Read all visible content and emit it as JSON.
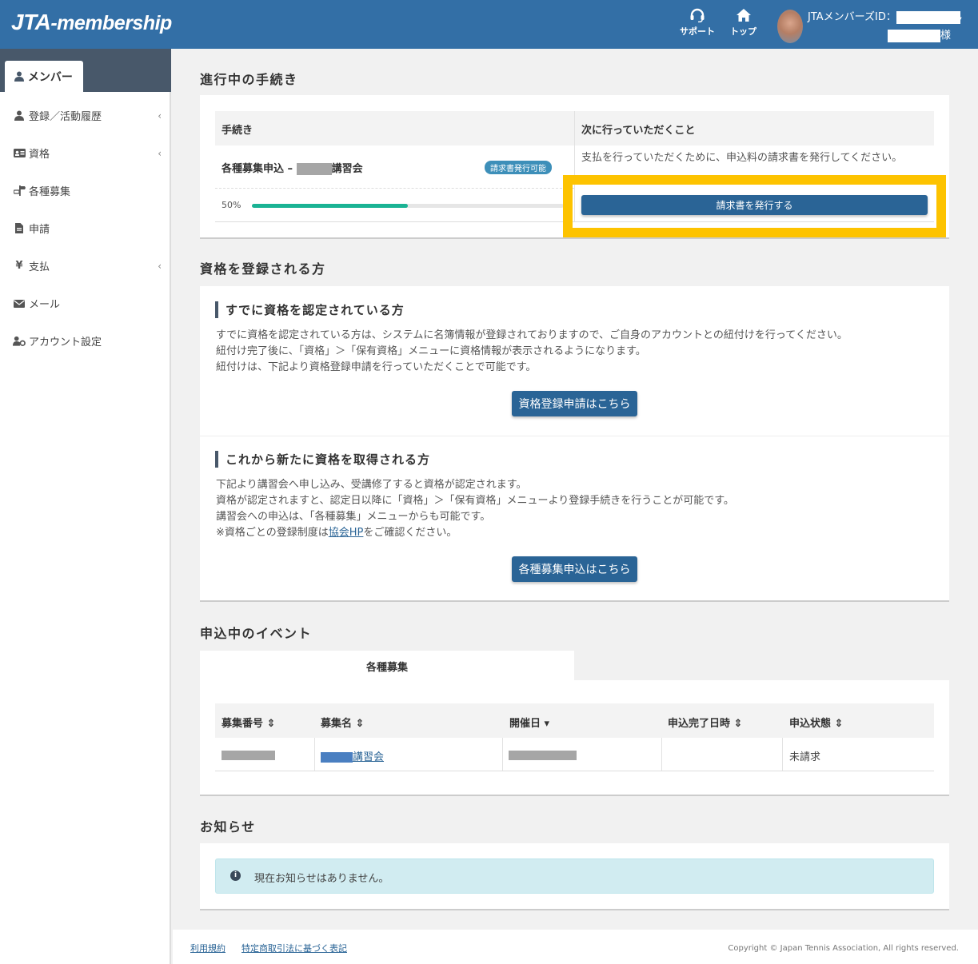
{
  "header": {
    "logo_main": "JTA",
    "logo_sub": "-membership",
    "support_label": "サポート",
    "top_label": "トップ",
    "user_id_label": "JTAメンバーズID：",
    "honorific": "様"
  },
  "sidebar": {
    "active_tab": "メンバー",
    "items": [
      {
        "label": "登録／活動履歴",
        "icon": "user-icon",
        "has_chevron": true
      },
      {
        "label": "資格",
        "icon": "id-card-icon",
        "has_chevron": true
      },
      {
        "label": "各種募集",
        "icon": "signpost-icon",
        "has_chevron": false
      },
      {
        "label": "申請",
        "icon": "file-icon",
        "has_chevron": false
      },
      {
        "label": "支払",
        "icon": "yen-icon",
        "has_chevron": true
      },
      {
        "label": "メール",
        "icon": "envelope-icon",
        "has_chevron": false
      },
      {
        "label": "アカウント設定",
        "icon": "user-cog-icon",
        "has_chevron": false
      }
    ],
    "chevron": "‹"
  },
  "procedures": {
    "title": "進行中の手続き",
    "col_procedure": "手続き",
    "col_next": "次に行っていただくこと",
    "item_name_prefix": "各種募集申込 –",
    "item_name_suffix": "講習会",
    "badge": "請求書発行可能",
    "progress_text": "50%",
    "progress_value": 0.5,
    "next_text": "支払を行っていただくために、申込料の請求書を発行してください。",
    "issue_button": "請求書を発行する",
    "highlight_color": "#fdc300"
  },
  "qualification": {
    "title": "資格を登録される方",
    "certified_heading": "すでに資格を認定されている方",
    "certified_lines": [
      "すでに資格を認定されている方は、システムに名簿情報が登録されておりますので、ご自身のアカウントとの紐付けを行ってください。",
      "紐付け完了後に、「資格」＞「保有資格」メニューに資格情報が表示されるようになります。",
      "紐付けは、下記より資格登録申請を行っていただくことで可能です。"
    ],
    "certified_button": "資格登録申請はこちら",
    "new_heading": "これから新たに資格を取得される方",
    "new_lines": [
      "下記より講習会へ申し込み、受講修了すると資格が認定されます。",
      "資格が認定されますと、認定日以降に「資格」＞「保有資格」メニューより登録手続きを行うことが可能です。",
      "講習会への申込は、「各種募集」メニューからも可能です。"
    ],
    "new_note_prefix": "※資格ごとの登録制度は",
    "new_note_link": "協会HP",
    "new_note_suffix": "をご確認ください。",
    "new_button": "各種募集申込はこちら"
  },
  "events": {
    "title": "申込中のイベント",
    "tab": "各種募集",
    "columns": [
      "募集番号 ⇕",
      "募集名 ⇕",
      "開催日 ▾",
      "申込完了日時 ⇕",
      "申込状態 ⇕"
    ],
    "row": {
      "name_suffix": "講習会",
      "completed_at": "",
      "status": "未請求"
    }
  },
  "notices": {
    "title": "お知らせ",
    "empty": "現在お知らせはありません。"
  },
  "footer": {
    "terms": "利用規約",
    "commerce": "特定商取引法に基づく表記",
    "copyright": "Copyright © Japan Tennis Association, All rights reserved."
  },
  "colors": {
    "header_bg": "#336fa6",
    "button_bg": "#2a6496",
    "progress": "#1ab394",
    "badge": "#3d8fb9",
    "notice_bg": "#d1ecf1"
  }
}
